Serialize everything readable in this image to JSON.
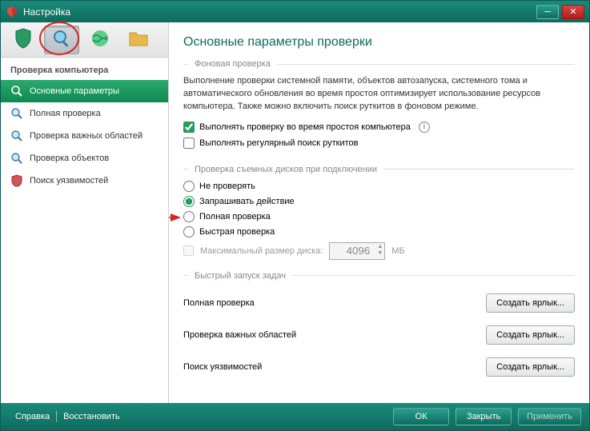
{
  "window": {
    "title": "Настройка"
  },
  "toolbar": {
    "icons": [
      "shield-icon",
      "magnifier-icon",
      "globe-icon",
      "folder-icon"
    ],
    "active_index": 1
  },
  "sidebar": {
    "heading": "Проверка компьютера",
    "items": [
      {
        "label": "Основные параметры",
        "icon": "magnifier-icon",
        "selected": true
      },
      {
        "label": "Полная проверка",
        "icon": "magnifier-icon"
      },
      {
        "label": "Проверка важных областей",
        "icon": "magnifier-icon"
      },
      {
        "label": "Проверка объектов",
        "icon": "magnifier-icon"
      },
      {
        "label": "Поиск уязвимостей",
        "icon": "shield-red-icon"
      }
    ]
  },
  "main": {
    "title": "Основные параметры проверки",
    "section1": {
      "legend": "Фоновая проверка",
      "desc": "Выполнение проверки системной памяти, объектов автозапуска, системного тома и автоматического обновления во время простоя оптимизирует использование ресурсов компьютера. Также можно включить поиск руткитов в фоновом режиме.",
      "chk_idle": "Выполнять проверку во время простоя компьютера",
      "chk_idle_checked": true,
      "chk_rootkit": "Выполнять регулярный поиск руткитов",
      "chk_rootkit_checked": false
    },
    "section2": {
      "legend": "Проверка съемных дисков при подключении",
      "options": [
        {
          "label": "Не проверять",
          "value": "none"
        },
        {
          "label": "Запрашивать действие",
          "value": "ask"
        },
        {
          "label": "Полная проверка",
          "value": "full"
        },
        {
          "label": "Быстрая проверка",
          "value": "quick"
        }
      ],
      "selected": "ask",
      "max_size_label": "Максимальный размер диска:",
      "max_size_value": "4096",
      "max_size_unit": "МБ",
      "max_size_enabled": false
    },
    "section3": {
      "legend": "Быстрый запуск задач",
      "rows": [
        {
          "label": "Полная проверка",
          "button": "Создать ярлык..."
        },
        {
          "label": "Проверка важных областей",
          "button": "Создать ярлык..."
        },
        {
          "label": "Поиск уязвимостей",
          "button": "Создать ярлык..."
        }
      ]
    }
  },
  "footer": {
    "help": "Справка",
    "restore": "Восстановить",
    "ok": "ОК",
    "close": "Закрыть",
    "apply": "Применить"
  }
}
